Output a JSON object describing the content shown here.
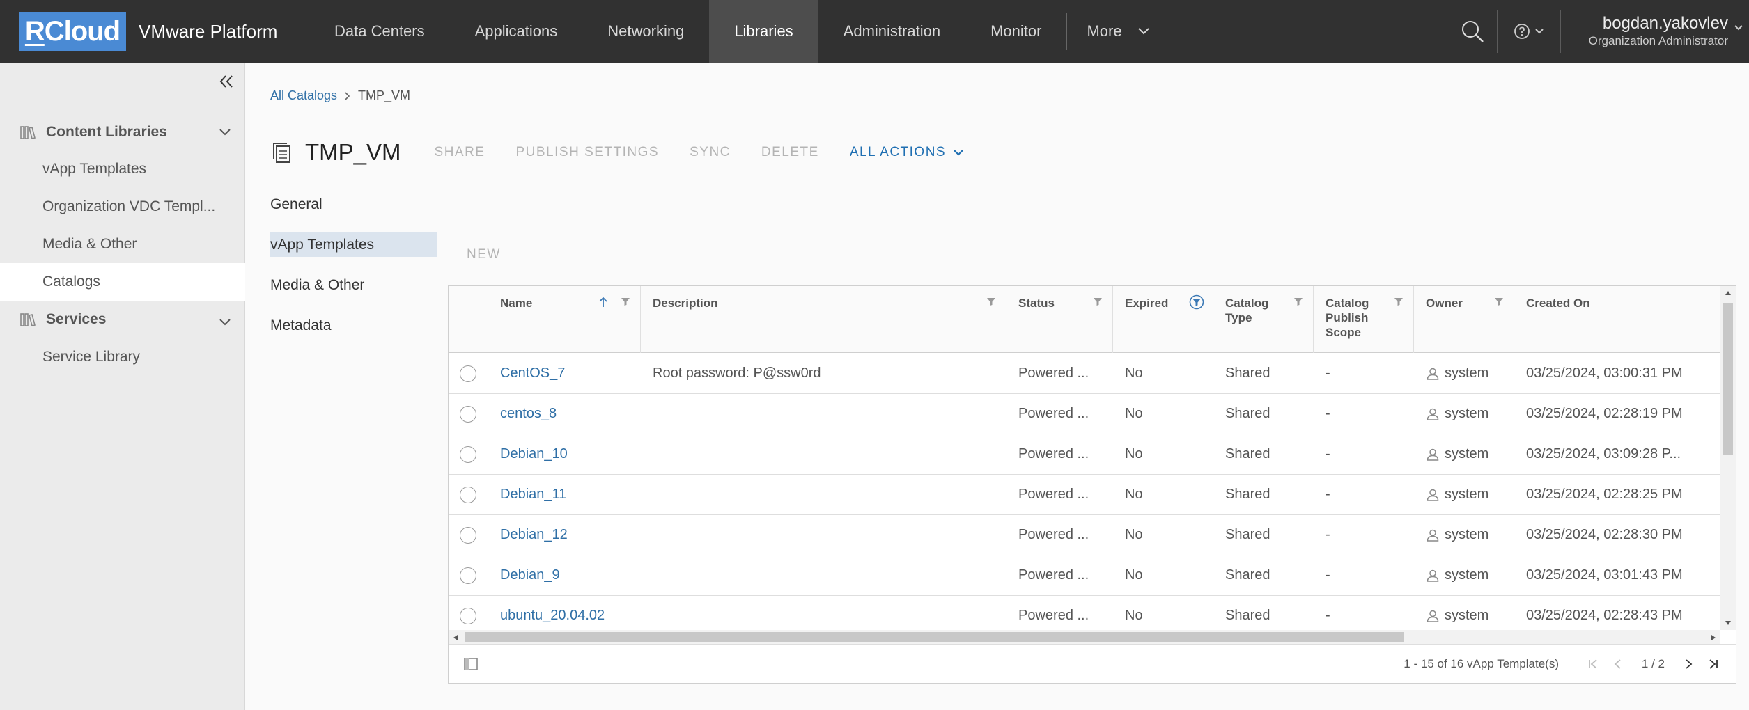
{
  "header": {
    "logo": "RCloud",
    "platform": "VMware Platform",
    "nav": [
      "Data Centers",
      "Applications",
      "Networking",
      "Libraries",
      "Administration",
      "Monitor"
    ],
    "more": "More",
    "user_name": "bogdan.yakovlev",
    "user_role": "Organization Administrator"
  },
  "sidebar": {
    "group1": "Content Libraries",
    "group1_items": [
      "vApp Templates",
      "Organization VDC Templ...",
      "Media & Other",
      "Catalogs"
    ],
    "group2": "Services",
    "group2_items": [
      "Service Library"
    ],
    "active_item": "Catalogs"
  },
  "breadcrumb": {
    "parent": "All Catalogs",
    "current": "TMP_VM"
  },
  "page": {
    "title": "TMP_VM",
    "actions": [
      "SHARE",
      "PUBLISH SETTINGS",
      "SYNC",
      "DELETE"
    ],
    "all_actions": "ALL ACTIONS"
  },
  "subnav": [
    "General",
    "vApp Templates",
    "Media & Other",
    "Metadata"
  ],
  "grid": {
    "new_label": "NEW",
    "columns": {
      "name": "Name",
      "description": "Description",
      "status": "Status",
      "expired": "Expired",
      "catalog_type": [
        "Catalog",
        "Type"
      ],
      "publish_scope": [
        "Catalog",
        "Publish",
        "Scope"
      ],
      "owner": "Owner",
      "created_on": "Created On"
    },
    "rows": [
      {
        "name": "CentOS_7",
        "description": "Root password: P@ssw0rd",
        "status": "Powered ...",
        "expired": "No",
        "type": "Shared",
        "scope": "-",
        "owner": "system",
        "created": "03/25/2024, 03:00:31 PM"
      },
      {
        "name": "centos_8",
        "description": "",
        "status": "Powered ...",
        "expired": "No",
        "type": "Shared",
        "scope": "-",
        "owner": "system",
        "created": "03/25/2024, 02:28:19 PM"
      },
      {
        "name": "Debian_10",
        "description": "",
        "status": "Powered ...",
        "expired": "No",
        "type": "Shared",
        "scope": "-",
        "owner": "system",
        "created": "03/25/2024, 03:09:28 P..."
      },
      {
        "name": "Debian_11",
        "description": "",
        "status": "Powered ...",
        "expired": "No",
        "type": "Shared",
        "scope": "-",
        "owner": "system",
        "created": "03/25/2024, 02:28:25 PM"
      },
      {
        "name": "Debian_12",
        "description": "",
        "status": "Powered ...",
        "expired": "No",
        "type": "Shared",
        "scope": "-",
        "owner": "system",
        "created": "03/25/2024, 02:28:30 PM"
      },
      {
        "name": "Debian_9",
        "description": "",
        "status": "Powered ...",
        "expired": "No",
        "type": "Shared",
        "scope": "-",
        "owner": "system",
        "created": "03/25/2024, 03:01:43 PM"
      },
      {
        "name": "ubuntu_20.04.02",
        "description": "",
        "status": "Powered ...",
        "expired": "No",
        "type": "Shared",
        "scope": "-",
        "owner": "system",
        "created": "03/25/2024, 02:28:43 PM"
      }
    ],
    "footer_count": "1 - 15 of 16 vApp Template(s)",
    "page": "1",
    "page_sep": "/",
    "pages": "2"
  },
  "colors": {
    "header_bg": "#313131",
    "logo_bg": "#4a8ad4",
    "link": "#2f6fa6",
    "primary_action": "#1f6fb2"
  },
  "icons": [
    "search-icon",
    "help-icon",
    "chevron-down-icon",
    "double-chevron-left-icon",
    "library-icon",
    "catalog-icon",
    "filter-icon",
    "sort-up-icon",
    "user-icon",
    "first-page-icon",
    "prev-page-icon",
    "next-page-icon",
    "last-page-icon",
    "column-toggle-icon"
  ]
}
